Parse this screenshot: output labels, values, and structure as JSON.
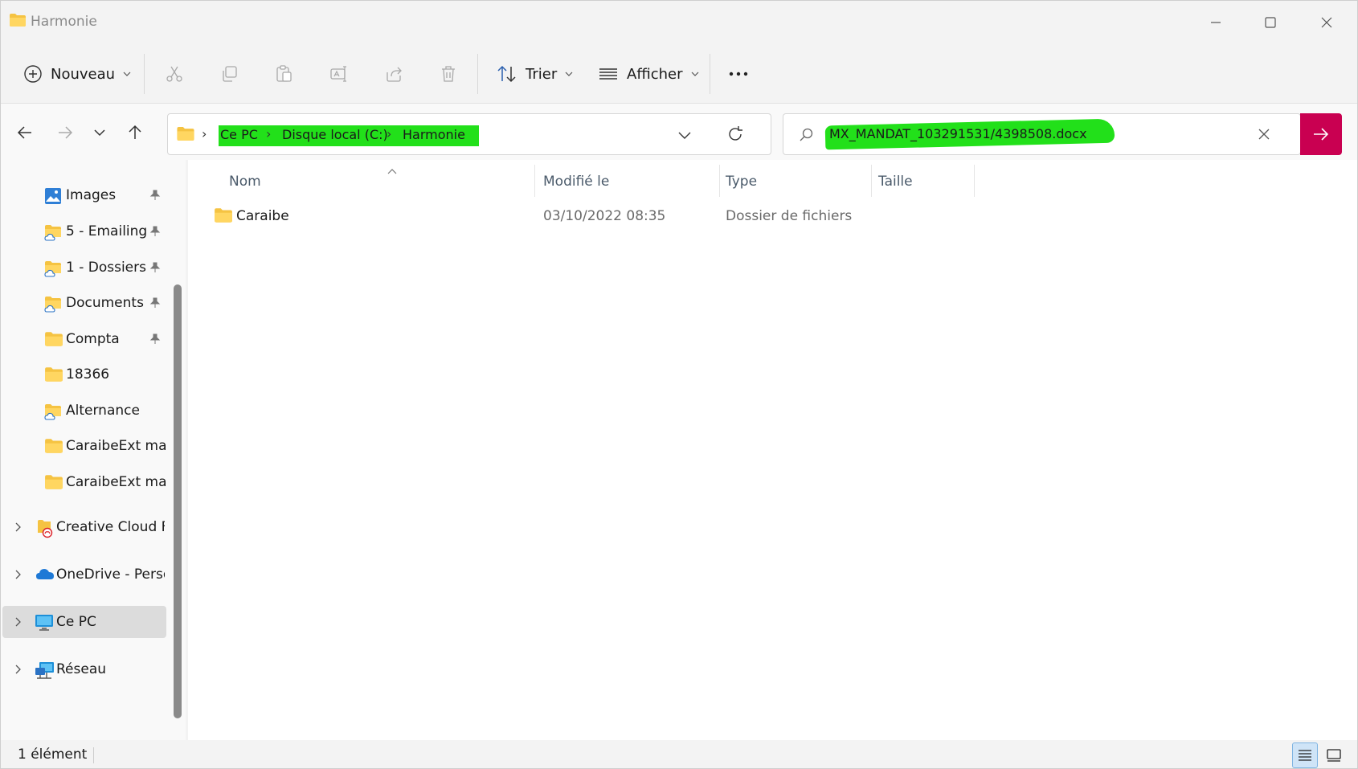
{
  "window": {
    "title": "Harmonie"
  },
  "toolbar": {
    "new_label": "Nouveau",
    "sort_label": "Trier",
    "view_label": "Afficher"
  },
  "address": {
    "crumbs": [
      "Ce PC",
      "Disque local (C:)",
      "Harmonie"
    ]
  },
  "search": {
    "value": "MX_MANDAT_103291531/4398508.docx"
  },
  "sidebar": {
    "quick_access": [
      {
        "label": "Images",
        "icon": "images-icon",
        "pinned": true
      },
      {
        "label": "5 - Emailing",
        "icon": "cloud-folder-icon",
        "pinned": true
      },
      {
        "label": "1 - Dossiers",
        "icon": "cloud-folder-icon",
        "pinned": true
      },
      {
        "label": "Documents",
        "icon": "cloud-folder-icon",
        "pinned": true
      },
      {
        "label": "Compta",
        "icon": "folder-icon",
        "pinned": true
      },
      {
        "label": "18366",
        "icon": "folder-icon",
        "pinned": false
      },
      {
        "label": "Alternance",
        "icon": "cloud-folder-icon",
        "pinned": false
      },
      {
        "label": "CaraibeExt man",
        "icon": "folder-icon",
        "pinned": false
      },
      {
        "label": "CaraibeExt man",
        "icon": "folder-icon",
        "pinned": false
      }
    ],
    "roots": [
      {
        "label": "Creative Cloud Fi",
        "icon": "creative-cloud-icon"
      },
      {
        "label": "OneDrive - Perso",
        "icon": "onedrive-icon"
      },
      {
        "label": "Ce PC",
        "icon": "this-pc-icon",
        "selected": true
      },
      {
        "label": "Réseau",
        "icon": "network-icon"
      }
    ]
  },
  "columns": {
    "name": "Nom",
    "modified": "Modifié le",
    "type": "Type",
    "size": "Taille"
  },
  "files": [
    {
      "name": "Caraibe",
      "modified": "03/10/2022 08:35",
      "type": "Dossier de fichiers",
      "size": ""
    }
  ],
  "status": {
    "count": "1 élément"
  },
  "colors": {
    "accent": "#c90051",
    "highlight": "#22e01a",
    "folder": "#f5c342"
  }
}
